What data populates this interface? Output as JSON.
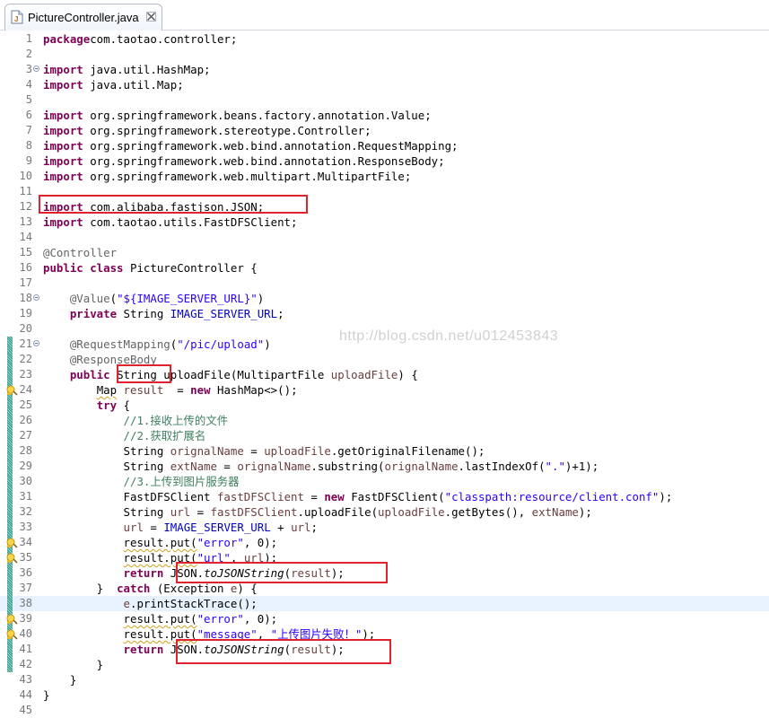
{
  "tab": {
    "title": "PictureController.java",
    "icon": "java-file-icon",
    "close_icon": "close-icon"
  },
  "watermark": "http://blog.csdn.net/u012453843",
  "lines": [
    {
      "n": "1",
      "segs": [
        [
          "kw",
          "package"
        ],
        [
          "",
          "com.taotao.controller;"
        ]
      ]
    },
    {
      "n": "2",
      "segs": []
    },
    {
      "n": "3",
      "fold": true,
      "segs": [
        [
          "kw",
          "import"
        ],
        [
          "",
          " java.util.HashMap;"
        ]
      ]
    },
    {
      "n": "4",
      "segs": [
        [
          "kw",
          "import"
        ],
        [
          "",
          " java.util.Map;"
        ]
      ]
    },
    {
      "n": "5",
      "segs": []
    },
    {
      "n": "6",
      "segs": [
        [
          "kw",
          "import"
        ],
        [
          "",
          " org.springframework.beans.factory.annotation.Value;"
        ]
      ]
    },
    {
      "n": "7",
      "segs": [
        [
          "kw",
          "import"
        ],
        [
          "",
          " org.springframework.stereotype.Controller;"
        ]
      ]
    },
    {
      "n": "8",
      "segs": [
        [
          "kw",
          "import"
        ],
        [
          "",
          " org.springframework.web.bind.annotation.RequestMapping;"
        ]
      ]
    },
    {
      "n": "9",
      "segs": [
        [
          "kw",
          "import"
        ],
        [
          "",
          " org.springframework.web.bind.annotation.ResponseBody;"
        ]
      ]
    },
    {
      "n": "10",
      "segs": [
        [
          "kw",
          "import"
        ],
        [
          "",
          " org.springframework.web.multipart.MultipartFile;"
        ]
      ]
    },
    {
      "n": "11",
      "segs": []
    },
    {
      "n": "12",
      "segs": [
        [
          "kw",
          "import"
        ],
        [
          "",
          " com.alibaba.fastjson.JSON;"
        ]
      ]
    },
    {
      "n": "13",
      "segs": [
        [
          "kw",
          "import"
        ],
        [
          "",
          " com.taotao.utils.FastDFSClient;"
        ]
      ]
    },
    {
      "n": "14",
      "segs": []
    },
    {
      "n": "15",
      "segs": [
        [
          "ann",
          "@Controller"
        ]
      ]
    },
    {
      "n": "16",
      "segs": [
        [
          "kw",
          "public class"
        ],
        [
          "",
          " PictureController {"
        ]
      ]
    },
    {
      "n": "17",
      "segs": []
    },
    {
      "n": "18",
      "fold": true,
      "segs": [
        [
          "",
          "    "
        ],
        [
          "ann",
          "@Value"
        ],
        [
          "",
          "("
        ],
        [
          "str",
          "\"${IMAGE_SERVER_URL}\""
        ],
        [
          "",
          ")"
        ]
      ]
    },
    {
      "n": "19",
      "segs": [
        [
          "",
          "    "
        ],
        [
          "kw",
          "private"
        ],
        [
          "",
          " String "
        ],
        [
          "fld",
          "IMAGE_SERVER_URL"
        ],
        [
          "",
          ";"
        ]
      ]
    },
    {
      "n": "20",
      "segs": []
    },
    {
      "n": "21",
      "fold": true,
      "mark": true,
      "segs": [
        [
          "",
          "    "
        ],
        [
          "ann",
          "@RequestMapping"
        ],
        [
          "",
          "("
        ],
        [
          "str",
          "\"/pic/upload\""
        ],
        [
          "",
          ")"
        ]
      ]
    },
    {
      "n": "22",
      "mark": true,
      "segs": [
        [
          "",
          "    "
        ],
        [
          "ann",
          "@ResponseBody"
        ]
      ]
    },
    {
      "n": "23",
      "mark": true,
      "segs": [
        [
          "",
          "    "
        ],
        [
          "kw",
          "public"
        ],
        [
          "",
          " String uploadFile(MultipartFile "
        ],
        [
          "var",
          "uploadFile"
        ],
        [
          "",
          ") {"
        ]
      ]
    },
    {
      "n": "24",
      "mark": true,
      "warn": true,
      "segs": [
        [
          "",
          "        "
        ],
        [
          "squig",
          "Map"
        ],
        [
          "",
          " "
        ],
        [
          "var",
          "result"
        ],
        [
          "",
          "  = "
        ],
        [
          "kw",
          "new"
        ],
        [
          "",
          " HashMap<>();"
        ]
      ]
    },
    {
      "n": "25",
      "mark": true,
      "segs": [
        [
          "",
          "        "
        ],
        [
          "kw",
          "try"
        ],
        [
          "",
          " {"
        ]
      ]
    },
    {
      "n": "26",
      "mark": true,
      "segs": [
        [
          "",
          "            "
        ],
        [
          "cmt",
          "//1.接收上传的文件"
        ]
      ]
    },
    {
      "n": "27",
      "mark": true,
      "segs": [
        [
          "",
          "            "
        ],
        [
          "cmt",
          "//2.获取扩展名"
        ]
      ]
    },
    {
      "n": "28",
      "mark": true,
      "segs": [
        [
          "",
          "            String "
        ],
        [
          "var",
          "orignalName"
        ],
        [
          "",
          " = "
        ],
        [
          "var",
          "uploadFile"
        ],
        [
          "",
          ".getOriginalFilename();"
        ]
      ]
    },
    {
      "n": "29",
      "mark": true,
      "segs": [
        [
          "",
          "            String "
        ],
        [
          "var",
          "extName"
        ],
        [
          "",
          " = "
        ],
        [
          "var",
          "orignalName"
        ],
        [
          "",
          ".substring("
        ],
        [
          "var",
          "orignalName"
        ],
        [
          "",
          ".lastIndexOf("
        ],
        [
          "str",
          "\".\""
        ],
        [
          "",
          ")+1);"
        ]
      ]
    },
    {
      "n": "30",
      "mark": true,
      "segs": [
        [
          "",
          "            "
        ],
        [
          "cmt",
          "//3.上传到图片服务器"
        ]
      ]
    },
    {
      "n": "31",
      "mark": true,
      "segs": [
        [
          "",
          "            FastDFSClient "
        ],
        [
          "var",
          "fastDFSClient"
        ],
        [
          "",
          " = "
        ],
        [
          "kw",
          "new"
        ],
        [
          "",
          " FastDFSClient("
        ],
        [
          "str",
          "\"classpath:resource/client.conf\""
        ],
        [
          "",
          ");"
        ]
      ]
    },
    {
      "n": "32",
      "mark": true,
      "segs": [
        [
          "",
          "            String "
        ],
        [
          "var",
          "url"
        ],
        [
          "",
          " = "
        ],
        [
          "var",
          "fastDFSClient"
        ],
        [
          "",
          ".uploadFile("
        ],
        [
          "var",
          "uploadFile"
        ],
        [
          "",
          ".getBytes(), "
        ],
        [
          "var",
          "extName"
        ],
        [
          "",
          ");"
        ]
      ]
    },
    {
      "n": "33",
      "mark": true,
      "segs": [
        [
          "",
          "            "
        ],
        [
          "var",
          "url"
        ],
        [
          "",
          " = "
        ],
        [
          "fld",
          "IMAGE_SERVER_URL"
        ],
        [
          "",
          " + "
        ],
        [
          "var",
          "url"
        ],
        [
          "",
          ";"
        ]
      ]
    },
    {
      "n": "34",
      "mark": true,
      "warn": true,
      "segs": [
        [
          "",
          "            "
        ],
        [
          "squig",
          "result.put("
        ],
        [
          "str",
          "\"error\""
        ],
        [
          "",
          ", 0);"
        ]
      ]
    },
    {
      "n": "35",
      "mark": true,
      "warn": true,
      "segs": [
        [
          "",
          "            "
        ],
        [
          "squig",
          "result.put("
        ],
        [
          "str",
          "\"url\""
        ],
        [
          "",
          ", "
        ],
        [
          "var",
          "url"
        ],
        [
          "",
          ");"
        ]
      ]
    },
    {
      "n": "36",
      "mark": true,
      "segs": [
        [
          "",
          "            "
        ],
        [
          "kw",
          "return"
        ],
        [
          "",
          " JSON."
        ],
        [
          "ital",
          "toJSONString"
        ],
        [
          "",
          "("
        ],
        [
          "var",
          "result"
        ],
        [
          "",
          ");"
        ]
      ]
    },
    {
      "n": "37",
      "mark": true,
      "segs": [
        [
          "",
          "        }  "
        ],
        [
          "kw",
          "catch"
        ],
        [
          "",
          " (Exception "
        ],
        [
          "var",
          "e"
        ],
        [
          "",
          ") {"
        ]
      ]
    },
    {
      "n": "38",
      "mark": true,
      "current": true,
      "segs": [
        [
          "",
          "            "
        ],
        [
          "var",
          "e"
        ],
        [
          "",
          ".printStackTrace();"
        ]
      ]
    },
    {
      "n": "39",
      "mark": true,
      "warn": true,
      "segs": [
        [
          "",
          "            "
        ],
        [
          "squig",
          "result.put("
        ],
        [
          "str",
          "\"error\""
        ],
        [
          "",
          ", 0);"
        ]
      ]
    },
    {
      "n": "40",
      "mark": true,
      "warn": true,
      "segs": [
        [
          "",
          "            "
        ],
        [
          "squig",
          "result.put("
        ],
        [
          "str",
          "\"message\""
        ],
        [
          "",
          ", "
        ],
        [
          "str",
          "\"上传图片失败！\""
        ],
        [
          "",
          ");"
        ]
      ]
    },
    {
      "n": "41",
      "mark": true,
      "segs": [
        [
          "",
          "            "
        ],
        [
          "kw",
          "return"
        ],
        [
          "",
          " JSON."
        ],
        [
          "ital",
          "toJSONString"
        ],
        [
          "",
          "("
        ],
        [
          "var",
          "result"
        ],
        [
          "",
          ");"
        ]
      ]
    },
    {
      "n": "42",
      "mark": true,
      "segs": [
        [
          "",
          "        }"
        ]
      ]
    },
    {
      "n": "43",
      "segs": [
        [
          "",
          "    }"
        ]
      ]
    },
    {
      "n": "44",
      "segs": [
        [
          "",
          "}"
        ]
      ]
    },
    {
      "n": "45",
      "segs": []
    }
  ],
  "colors": {
    "highlight_box": "#e0222e",
    "keyword": "#7f0055",
    "string": "#2a00ff",
    "comment": "#3f7f5f",
    "field": "#0000c0",
    "annotation": "#646464"
  }
}
